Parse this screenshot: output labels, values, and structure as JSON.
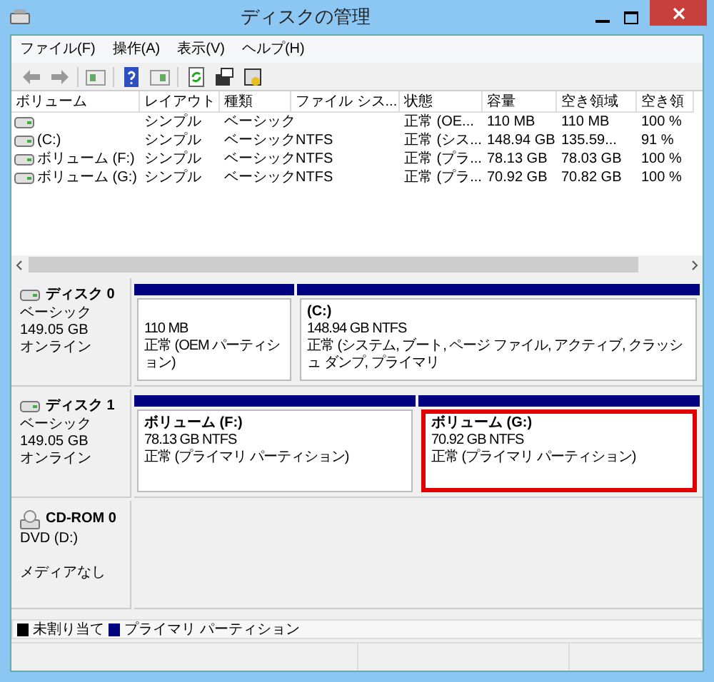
{
  "window": {
    "title": "ディスクの管理"
  },
  "menu": [
    {
      "label": "ファイル(F)"
    },
    {
      "label": "操作(A)"
    },
    {
      "label": "表示(V)"
    },
    {
      "label": "ヘルプ(H)"
    }
  ],
  "volume_list": {
    "columns": [
      "ボリューム",
      "レイアウト",
      "種類",
      "ファイル シス...",
      "状態",
      "容量",
      "空き領域",
      "空き領"
    ],
    "rows": [
      {
        "cells": [
          "",
          "シンプル",
          "ベーシック",
          "",
          "正常 (OE...",
          "110 MB",
          "110 MB",
          "100 %"
        ]
      },
      {
        "cells": [
          "(C:)",
          "シンプル",
          "ベーシック",
          "NTFS",
          "正常 (シス...",
          "148.94 GB",
          "135.59...",
          "91 %"
        ]
      },
      {
        "cells": [
          "ボリューム (F:)",
          "シンプル",
          "ベーシック",
          "NTFS",
          "正常 (プラ...",
          "78.13 GB",
          "78.03 GB",
          "100 %"
        ]
      },
      {
        "cells": [
          "ボリューム (G:)",
          "シンプル",
          "ベーシック",
          "NTFS",
          "正常 (プラ...",
          "70.92 GB",
          "70.82 GB",
          "100 %"
        ]
      }
    ]
  },
  "disks": [
    {
      "kind": "disk",
      "name": "ディスク 0",
      "lines": [
        "ベーシック",
        "149.05 GB",
        "オンライン"
      ],
      "partitions": [
        {
          "lines": [
            "110 MB",
            "正常 (OEM パーティション)"
          ],
          "highlighted": false
        },
        {
          "name": "(C:)",
          "lines": [
            "148.94 GB NTFS",
            "正常 (システム, ブート, ページ ファイル, アクティブ, クラッシュ ダンプ, プライマリ"
          ],
          "highlighted": false
        }
      ]
    },
    {
      "kind": "disk",
      "name": "ディスク 1",
      "lines": [
        "ベーシック",
        "149.05 GB",
        "オンライン"
      ],
      "partitions": [
        {
          "name": "ボリューム (F:)",
          "lines": [
            "78.13 GB NTFS",
            "正常 (プライマリ パーティション)"
          ],
          "highlighted": false
        },
        {
          "name": "ボリューム (G:)",
          "lines": [
            "70.92 GB NTFS",
            "正常 (プライマリ パーティション)"
          ],
          "highlighted": true
        }
      ]
    },
    {
      "kind": "cdrom",
      "name": "CD-ROM 0",
      "lines": [
        "DVD (D:)",
        "メディアなし"
      ]
    }
  ],
  "legend": [
    {
      "label": "未割り当て",
      "color": "#000000"
    },
    {
      "label": "プライマリ パーティション",
      "color": "#000080"
    }
  ]
}
